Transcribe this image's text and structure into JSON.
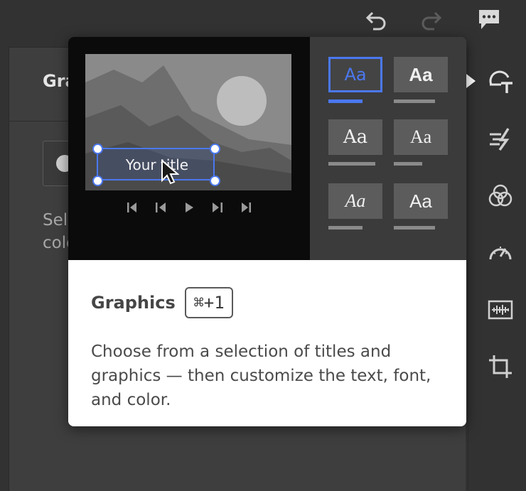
{
  "panel": {
    "title": "Gra",
    "description": "Sele colo"
  },
  "popover": {
    "preview_title": "Your title",
    "heading": "Graphics",
    "shortcut": "⌘+1",
    "description": "Choose from a selection of titles and graphics — then customize the text, font, and color.",
    "styles": [
      {
        "label": "Aa",
        "selected": true
      },
      {
        "label": "Aa",
        "selected": false
      },
      {
        "label": "Aa",
        "selected": false
      },
      {
        "label": "Aa",
        "selected": false
      },
      {
        "label": "Aa",
        "selected": false
      },
      {
        "label": "Aa",
        "selected": false
      }
    ]
  },
  "icons": {
    "toolbar": [
      "undo-icon",
      "redo-icon",
      "comment-icon"
    ],
    "rail": [
      "titles-icon",
      "transitions-icon",
      "color-icon",
      "speed-icon",
      "audio-icon",
      "crop-icon"
    ],
    "player": [
      "skip-start-icon",
      "step-back-icon",
      "play-icon",
      "step-forward-icon",
      "skip-end-icon"
    ]
  },
  "colors": {
    "accent": "#4b78f0",
    "background": "#323232",
    "panel": "#3e3e3e"
  }
}
